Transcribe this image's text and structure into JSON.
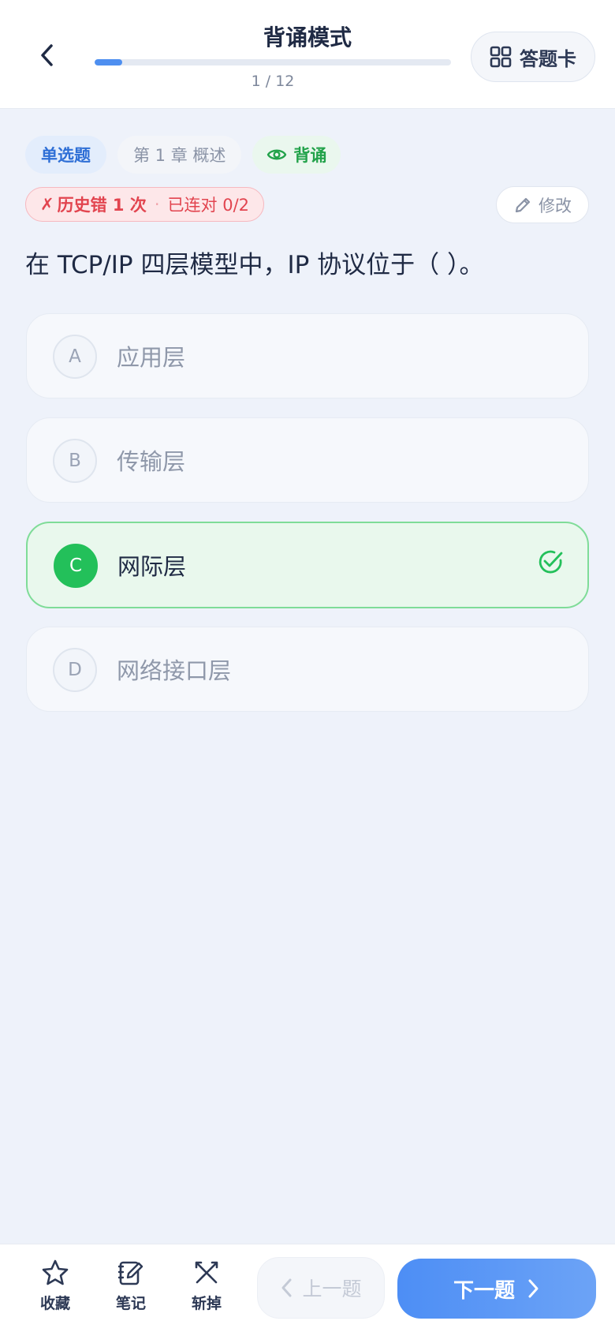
{
  "header": {
    "title": "背诵模式",
    "progress_text": "1 / 12",
    "progress_fraction": 0.077,
    "answer_card_label": "答题卡",
    "back_icon": "chevron-left-icon",
    "card_icon": "grid-icon"
  },
  "tags": {
    "type": "单选题",
    "chapter": "第 1 章 概述",
    "mode": "背诵",
    "mode_icon": "eye-icon"
  },
  "history": {
    "mark": "✗",
    "error_text": "历史错 1 次",
    "separator": "·",
    "streak_text": "已连对 0/2"
  },
  "edit_label": "修改",
  "question": "在 TCP/IP 四层模型中，IP 协议位于（ ）。",
  "options": [
    {
      "letter": "A",
      "text": "应用层",
      "correct": false
    },
    {
      "letter": "B",
      "text": "传输层",
      "correct": false
    },
    {
      "letter": "C",
      "text": "网际层",
      "correct": true
    },
    {
      "letter": "D",
      "text": "网络接口层",
      "correct": false
    }
  ],
  "bottom": {
    "favorite_label": "收藏",
    "note_label": "笔记",
    "remove_label": "斩掉",
    "prev_label": "上一题",
    "next_label": "下一题"
  },
  "colors": {
    "accent": "#4e8ff0",
    "correct": "#23c05a",
    "error": "#e2444f"
  }
}
